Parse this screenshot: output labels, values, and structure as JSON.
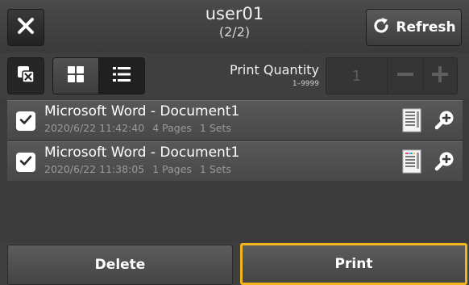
{
  "header": {
    "user": "user01",
    "count": "(2/2)",
    "refresh_label": "Refresh",
    "close_icon": "close-icon",
    "refresh_icon": "refresh-icon"
  },
  "toolbar": {
    "print_quantity_label": "Print Quantity",
    "print_quantity_range": "1–9999",
    "quantity_value": "1",
    "active_view": "list"
  },
  "jobs": [
    {
      "name": "Microsoft Word - Document1",
      "datetime": "2020/6/22 11:42:40",
      "pages": "4 Pages",
      "sets": "1 Sets",
      "checked": true
    },
    {
      "name": "Microsoft Word - Document1",
      "datetime": "2020/6/22 11:38:05",
      "pages": "1 Pages",
      "sets": "1 Sets",
      "checked": true
    }
  ],
  "footer": {
    "delete_label": "Delete",
    "print_label": "Print"
  },
  "colors": {
    "accent": "#f2b61c",
    "background": "#3b3b3b"
  }
}
